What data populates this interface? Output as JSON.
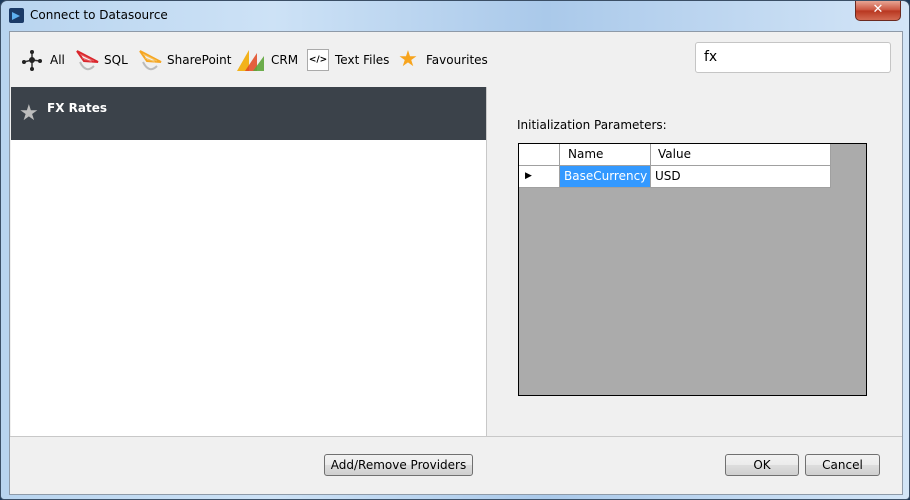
{
  "window": {
    "title": "Connect to Datasource",
    "close_label": "✕"
  },
  "toolbar": {
    "items": [
      {
        "label": "All",
        "icon": "network-icon"
      },
      {
        "label": "SQL",
        "icon": "sql-server-icon"
      },
      {
        "label": "SharePoint",
        "icon": "sharepoint-icon"
      },
      {
        "label": "CRM",
        "icon": "crm-icon"
      },
      {
        "label": "Text Files",
        "icon": "code-icon"
      },
      {
        "label": "Favourites",
        "icon": "star-icon"
      }
    ],
    "code_glyph": "</>",
    "star_glyph": "★"
  },
  "search": {
    "value": "fx",
    "placeholder": ""
  },
  "providers": [
    {
      "name": "FX Rates",
      "icon": "star-icon",
      "selected": true
    }
  ],
  "provider_star_glyph": "★",
  "parameters": {
    "label": "Initialization Parameters:",
    "columns": [
      "Name",
      "Value"
    ],
    "rows": [
      {
        "name": "BaseCurrency",
        "value": "USD",
        "current": true
      }
    ],
    "row_indicator": "▶"
  },
  "buttons": {
    "add_remove": "Add/Remove Providers",
    "ok": "OK",
    "cancel": "Cancel"
  },
  "colors": {
    "selected_provider_bg": "#3b424a",
    "selected_cell_bg": "#3399ff",
    "favourite_star": "#f7a41d",
    "grid_background": "#ababab"
  }
}
